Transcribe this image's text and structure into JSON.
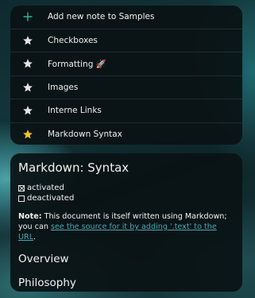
{
  "notes_list": {
    "rows": [
      {
        "label": "Add new note to Samples",
        "icon": "plus-icon",
        "icon_color": "#2bb3a0"
      },
      {
        "label": "Checkboxes",
        "icon": "star-outline-icon",
        "icon_color": "#d8d8d8"
      },
      {
        "label": "Formatting 🚀",
        "icon": "star-outline-icon",
        "icon_color": "#d8d8d8"
      },
      {
        "label": "Images",
        "icon": "star-outline-icon",
        "icon_color": "#d8d8d8"
      },
      {
        "label": "Interne Links",
        "icon": "star-outline-icon",
        "icon_color": "#d8d8d8"
      },
      {
        "label": "Markdown Syntax",
        "icon": "star-filled-icon",
        "icon_color": "#f5c518"
      }
    ]
  },
  "note": {
    "title": "Markdown: Syntax",
    "tasks": [
      {
        "label": "activated",
        "checked": true
      },
      {
        "label": "deactivated",
        "checked": false
      }
    ],
    "paragraph": {
      "bold": "Note:",
      "text": " This document is itself written using Markdown; you can ",
      "link": "see the source for it by adding '.text' to the URL",
      "end": "."
    },
    "headings": [
      "Overview",
      "Philosophy"
    ]
  },
  "colors": {
    "accent": "#2bb3a0",
    "link": "#4aa8b5",
    "favorite": "#f5c518"
  }
}
